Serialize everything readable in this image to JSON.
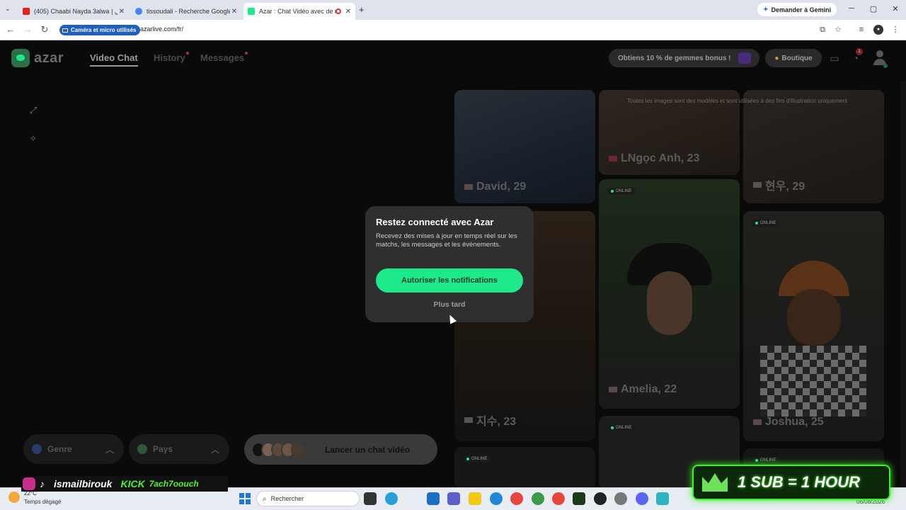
{
  "browser": {
    "tabs": [
      {
        "title": "(405) Chaabi Nayda 3alwa | شعبي",
        "favicon_color": "#e62117",
        "active": false
      },
      {
        "title": "tissoudali - Recherche Google",
        "favicon_color": "#4285f4",
        "active": false
      },
      {
        "title": "Azar : Chat Vidéo avec de n",
        "favicon_color": "#1de98b",
        "active": true
      }
    ],
    "new_tab": "+",
    "gemini_label": "Demander à Gemini",
    "cam_chip_label": "Caméra et micro utilisés",
    "url": "azarlive.com/fr/"
  },
  "app": {
    "logo_text": "azar",
    "nav": [
      {
        "label": "Video Chat",
        "active": true
      },
      {
        "label": "History",
        "active": false
      },
      {
        "label": "Messages",
        "active": false
      }
    ],
    "gems_promo": "Obtiens 10 % de gemmes bonus !",
    "shop_label": "Boutique",
    "notification_count": "1",
    "disclaimer": "Toutes les images sont des modèles et sont utilisées à des fins d'illustration uniquement",
    "filters": {
      "gender_label": "Genre",
      "country_label": "Pays"
    },
    "launch_label": "Lancer un chat vidéo"
  },
  "cards": [
    {
      "name": "David, 29",
      "flag": "us",
      "online": false
    },
    {
      "name": "LNgọc Anh, 23",
      "flag": "vn",
      "online": false
    },
    {
      "name": "현우, 29",
      "flag": "kr",
      "online": false
    },
    {
      "name": "Amelia, 22",
      "flag": "us",
      "online": true
    },
    {
      "name": "지수, 23",
      "flag": "kr",
      "online": false
    },
    {
      "name": "Joshua, 25",
      "flag": "us",
      "online": true
    },
    {
      "name": "",
      "flag": "",
      "online": true
    },
    {
      "name": "",
      "flag": "",
      "online": true
    },
    {
      "name": "",
      "flag": "",
      "online": true
    }
  ],
  "online_badge": "ONLINE",
  "modal": {
    "title": "Restez connecté avec Azar",
    "body": "Recevez des mises à jour en temps réel sur les matchs, les messages et les évènements.",
    "allow_button": "Autoriser les notifications",
    "later_button": "Plus tard"
  },
  "overlay": {
    "streamer_name": "ismailbirouk",
    "kick_label": "KICK",
    "kick_user": "7ach7oouch",
    "sub_banner": "1 SUB = 1 HOUR"
  },
  "taskbar": {
    "temperature": "22°C",
    "weather": "Temps dégagé",
    "search_placeholder": "Rechercher",
    "date": "06/08/2026"
  },
  "colors": {
    "accent": "#1de98b",
    "background": "#0a0a0a",
    "modal_bg": "#2f2f2f"
  }
}
